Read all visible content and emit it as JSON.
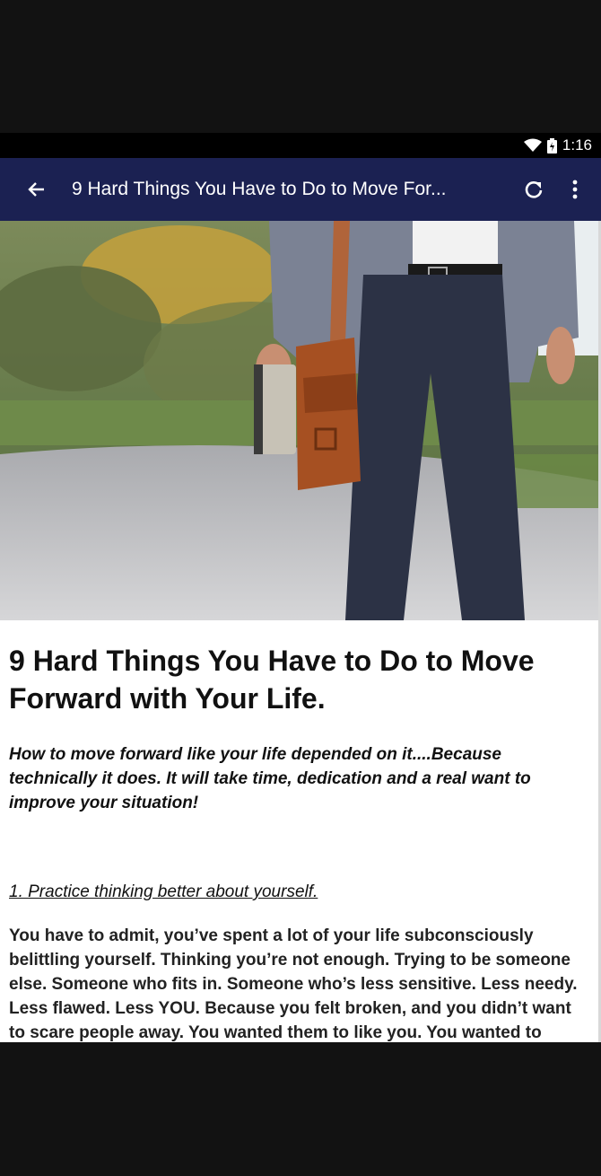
{
  "status_bar": {
    "time": "1:16"
  },
  "app_bar": {
    "title": "9 Hard Things You Have to Do to Move For..."
  },
  "article": {
    "title": "9 Hard Things You Have to Do to Move Forward with Your Life.",
    "intro": "How to move forward like your life depended on it....Because technically it does. It will take time, dedication and a real want to improve your situation!",
    "section_heading": "1.  Practice thinking better about yourself.",
    "body": "You have to admit, you’ve spent a lot of your life subconsciously belittling yourself.  Thinking you’re not enough.  Trying to be someone else.  Someone who fits in.  Someone who’s less sensitive.  Less needy.  Less flawed.  Less YOU.  Because you felt broken, and you didn’t want to scare people away.  You wanted them to like you.  You wanted to make everything easier.  You wanted to"
  },
  "colors": {
    "app_bar": "#1b2152",
    "status_bar": "#000000"
  }
}
